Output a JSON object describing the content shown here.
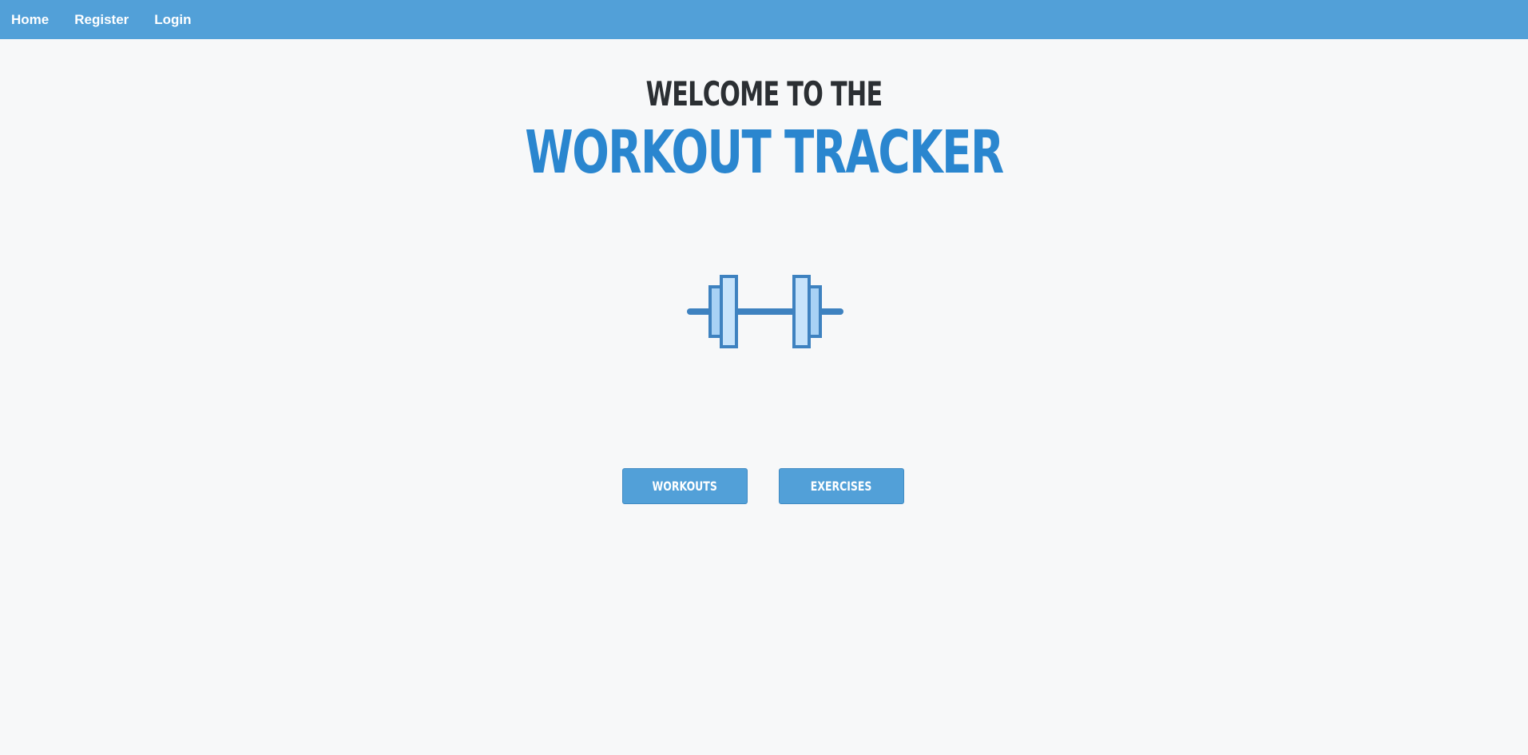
{
  "nav": {
    "items": [
      {
        "label": "Home"
      },
      {
        "label": "Register"
      },
      {
        "label": "Login"
      }
    ]
  },
  "hero": {
    "welcome": "WELCOME TO THE",
    "title": "WORKOUT TRACKER",
    "icon": "barbell-icon"
  },
  "actions": {
    "workouts_label": "WORKOUTS",
    "exercises_label": "EXERCISES"
  },
  "colors": {
    "navbar": "#52a0d8",
    "title": "#2a86cf",
    "welcome": "#2b2f33",
    "background": "#f7f8f9",
    "button": "#52a0d8"
  }
}
